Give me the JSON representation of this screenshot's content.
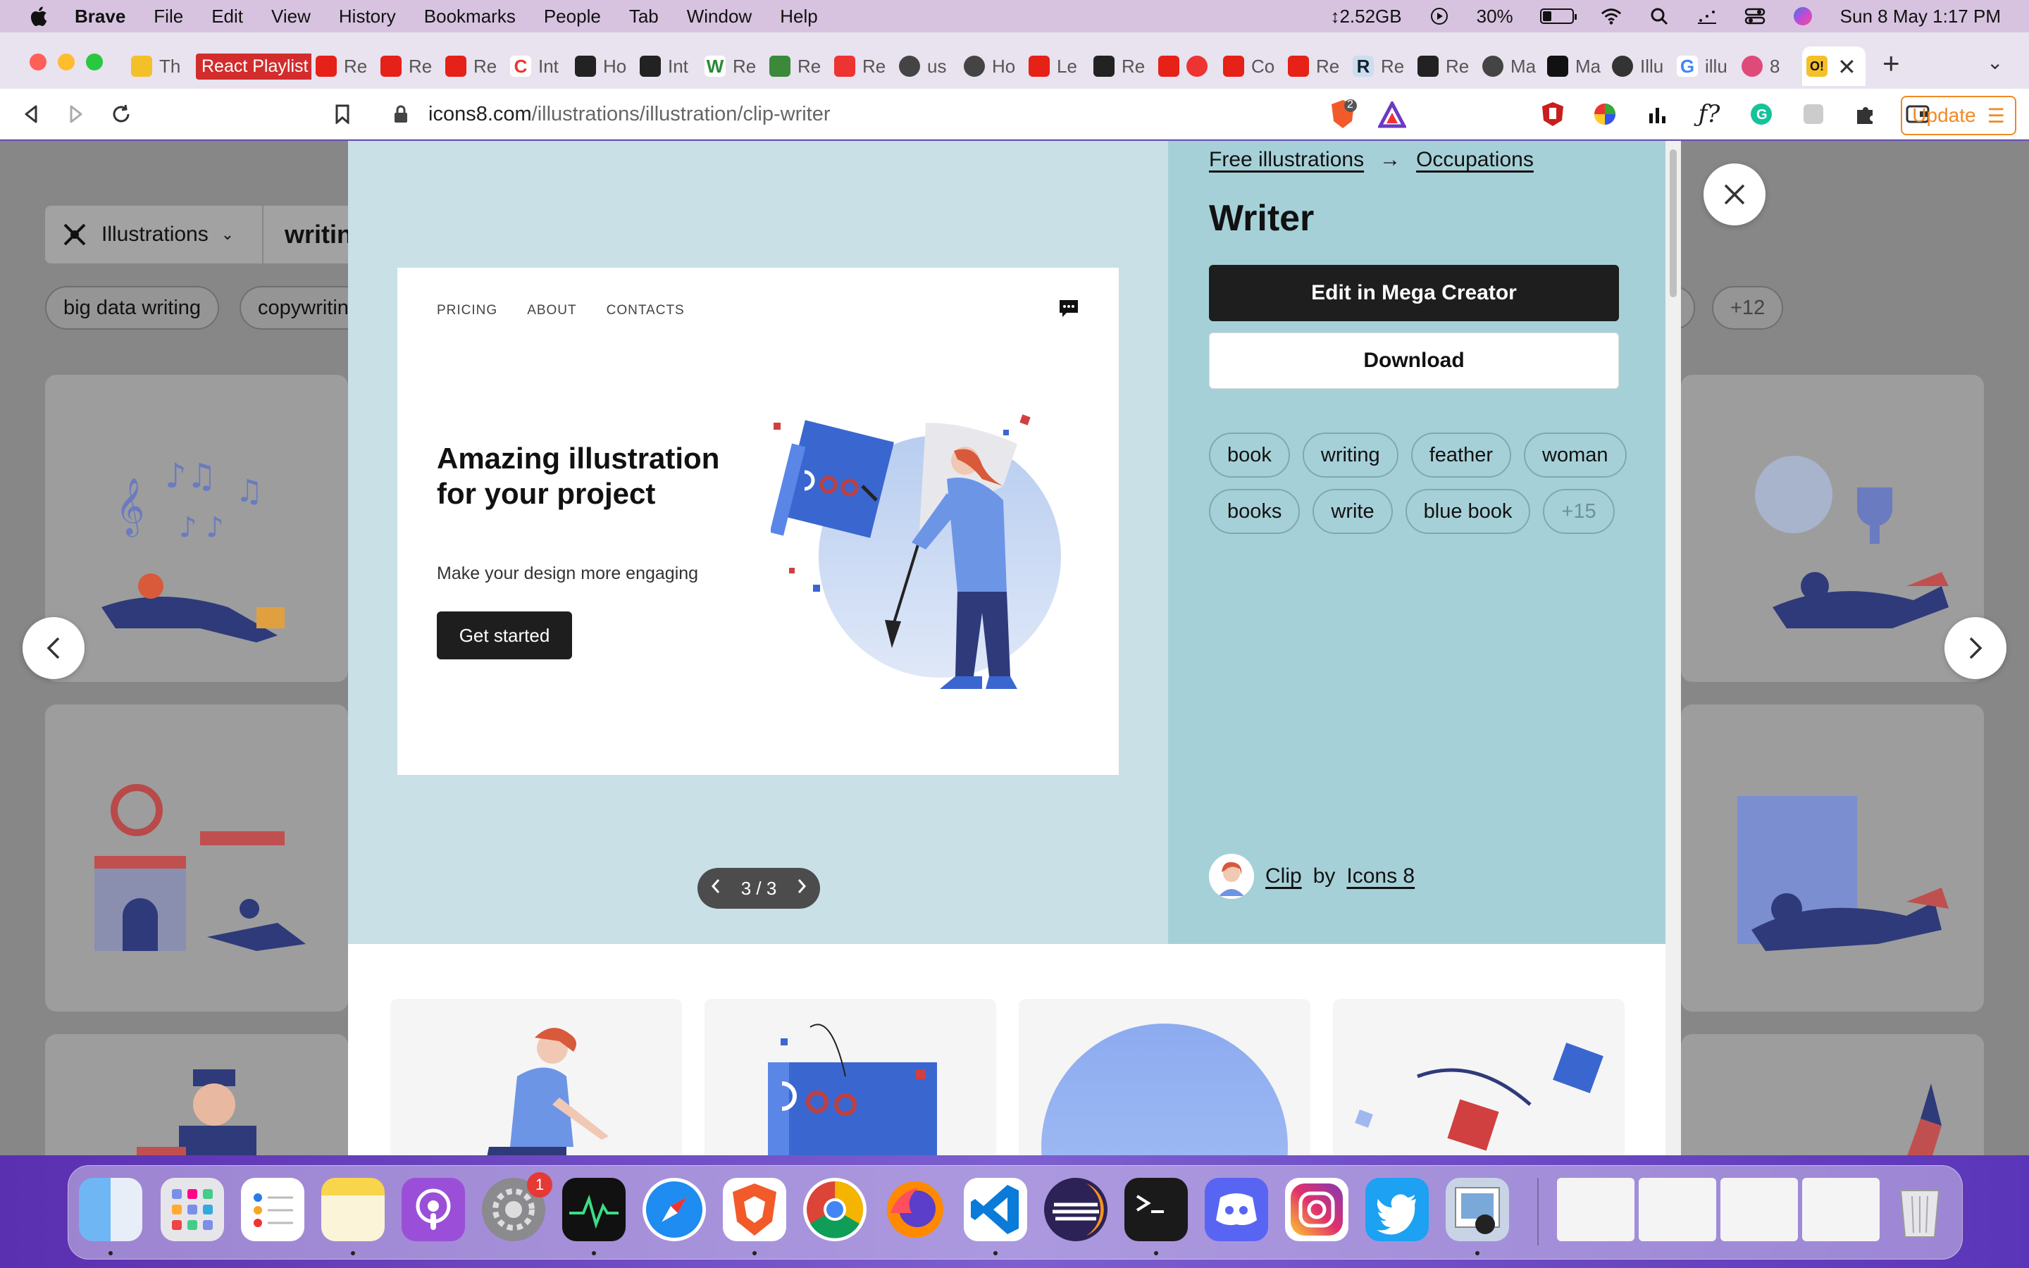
{
  "menubar": {
    "app": "Brave",
    "items": [
      "File",
      "Edit",
      "View",
      "History",
      "Bookmarks",
      "People",
      "Tab",
      "Window",
      "Help"
    ],
    "memory": "↕2.52GB",
    "battery": "30%",
    "battery_level": 0.3,
    "datetime": "Sun 8 May  1:17 PM"
  },
  "tabs": {
    "first": "Th",
    "react_playlist": "React Playlist",
    "labels": [
      "Re",
      "Re",
      "Re",
      "Int",
      "Ho",
      "Int",
      "Re",
      "Re",
      "Re",
      "us",
      "Ho",
      "Le",
      "Re",
      "Co",
      "Re",
      "Re",
      "Re",
      "Ma",
      "Ma",
      "Illu",
      "illu",
      "8"
    ]
  },
  "toolbar": {
    "url_host": "icons8.com",
    "url_path": "/illustrations/illustration/clip-writer",
    "shield_count": "2",
    "update_label": "Update"
  },
  "background_page": {
    "category": "Illustrations",
    "query": "writin",
    "chips": [
      "big data writing",
      "copywritin",
      "+12"
    ]
  },
  "modal": {
    "breadcrumb": [
      "Free illustrations",
      "Occupations"
    ],
    "breadcrumb_arrow": "→",
    "title": "Writer",
    "edit_label": "Edit in Mega Creator",
    "download_label": "Download",
    "tags": [
      "book",
      "writing",
      "feather",
      "woman",
      "books",
      "write",
      "blue book"
    ],
    "more_tags": "+15",
    "author_prefix": "Clip",
    "author_by": "by",
    "author_name": "Icons 8",
    "pager": "3 / 3",
    "preview": {
      "nav": [
        "PRICING",
        "ABOUT",
        "CONTACTS"
      ],
      "headline": "Amazing illustration for your project",
      "subtext": "Make your design more engaging",
      "cta": "Get started"
    }
  },
  "dock": {
    "badge_count": "1",
    "apps": [
      "Finder",
      "Launchpad",
      "Reminders",
      "Notes",
      "Podcasts",
      "System Preferences",
      "Activity Monitor",
      "Safari",
      "Brave",
      "Chrome",
      "Firefox",
      "VS Code",
      "Eclipse",
      "Terminal",
      "Discord",
      "Instagram",
      "Twitter",
      "Preview",
      "Trash"
    ]
  },
  "colors": {
    "accent_update": "#f08a24",
    "preview_bg": "#c8e0e6",
    "info_bg": "#a6d0d8",
    "react_playlist": "#d22c2c"
  }
}
